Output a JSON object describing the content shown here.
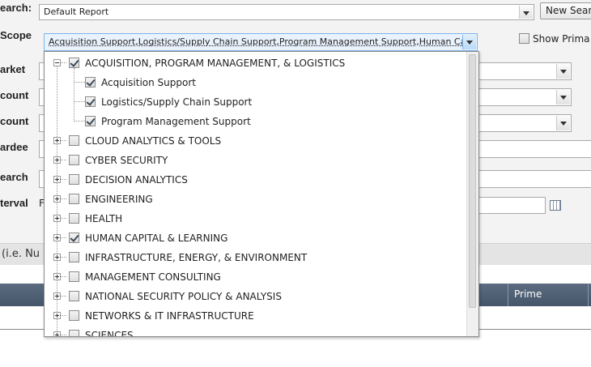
{
  "labels": {
    "search": "earch:",
    "scope": "Scope",
    "market": "arket",
    "account1": "count",
    "account2": "count",
    "awardee": "ardee",
    "search2": "earch",
    "interval": "terval",
    "interval_prefix": "F"
  },
  "search": {
    "value": "Default Report",
    "new_button": "New Sear"
  },
  "scope": {
    "value": "Acquisition Support,Logistics/Supply Chain Support,Program Management Support,Human Cap",
    "show_prime_label": "Show Prima"
  },
  "hint_text": "(i.e. Nu",
  "table_header": {
    "prime": "Prime"
  },
  "tree": [
    {
      "label": "ACQUISITION, PROGRAM MANAGEMENT, & LOGISTICS",
      "checked": true,
      "expanded": true,
      "children": [
        {
          "label": "Acquisition Support",
          "checked": true
        },
        {
          "label": "Logistics/Supply Chain Support",
          "checked": true
        },
        {
          "label": "Program Management Support",
          "checked": true
        }
      ]
    },
    {
      "label": "CLOUD ANALYTICS & TOOLS",
      "checked": false
    },
    {
      "label": "CYBER SECURITY",
      "checked": false
    },
    {
      "label": "DECISION ANALYTICS",
      "checked": false
    },
    {
      "label": "ENGINEERING",
      "checked": false
    },
    {
      "label": "HEALTH",
      "checked": false
    },
    {
      "label": "HUMAN CAPITAL & LEARNING",
      "checked": true
    },
    {
      "label": "INFRASTRUCTURE, ENERGY, & ENVIRONMENT",
      "checked": false
    },
    {
      "label": "MANAGEMENT CONSULTING",
      "checked": false
    },
    {
      "label": "NATIONAL SECURITY POLICY & ANALYSIS",
      "checked": false
    },
    {
      "label": "NETWORKS & IT INFRASTRUCTURE",
      "checked": false
    },
    {
      "label": "SCIENCES",
      "checked": false
    }
  ]
}
